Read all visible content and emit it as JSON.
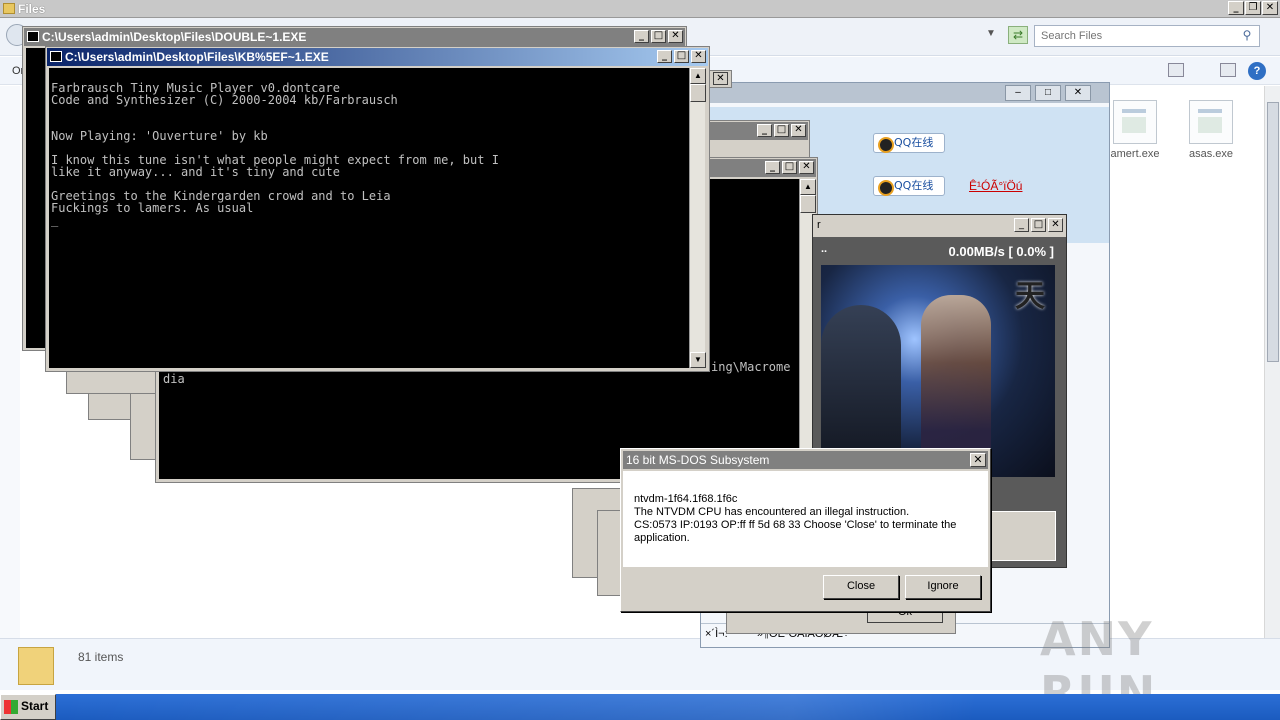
{
  "explorer": {
    "title": "Files",
    "search_placeholder": "Search Files",
    "organize_label": "Or",
    "items_count": "81 items",
    "files": [
      {
        "name": "amert.exe"
      },
      {
        "name": "asas.exe"
      }
    ]
  },
  "taskbar": {
    "start_label": "Start"
  },
  "cmd_back": {
    "title": "C:\\Users\\admin\\Desktop\\Files\\DOUBLE~1.EXE"
  },
  "cmd_front": {
    "title": "C:\\Users\\admin\\Desktop\\Files\\KB%5EF~1.EXE",
    "console_text": "Farbrausch Tiny Music Player v0.dontcare\nCode and Synthesizer (C) 2000-2004 kb/Farbrausch\n\n\nNow Playing: 'Ouverture' by kb\n\nI know this tune isn't what people might expect from me, but I\nlike it anyway... and it's tiny and cute\n\nGreetings to the Kindergarden crowd and to Leia\nFuckings to lamers. As usual\n_"
  },
  "cmd_mid": {
    "console_frag_1": "ing\\Macrome",
    "console_frag_2": "dia"
  },
  "qq": {
    "btn1": "QQ在线",
    "btn2": "QQ在线",
    "link": "Ê¹ÓÃ°ïÖú",
    "status_left": "×´Ì¬:",
    "status_right": "»¶Ó­Ê¹ÓÃÏÂÔØÆ÷"
  },
  "game": {
    "speed": "0.00MB/s [ 0.0% ]",
    "dots": "..",
    "title_frag": "r",
    "logo_text": "天"
  },
  "small_ok": "Ok",
  "dialog": {
    "title": "16 bit MS-DOS Subsystem",
    "line1": "ntvdm-1f64.1f68.1f6c",
    "line2": "The NTVDM CPU has encountered an illegal instruction.",
    "line3": "CS:0573 IP:0193 OP:ff ff 5d 68 33 Choose 'Close' to terminate the application.",
    "close_label": "Close",
    "ignore_label": "Ignore"
  },
  "watermark": "ANY RUN"
}
